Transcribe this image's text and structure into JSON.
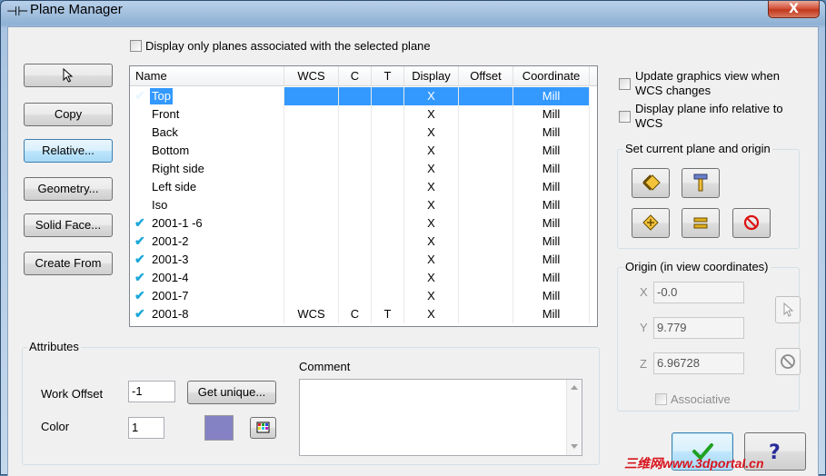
{
  "window": {
    "title": "Plane Manager",
    "close_glyph": "X"
  },
  "top_checkbox": {
    "label": "Display only planes associated with the selected plane"
  },
  "left_buttons": [
    "Copy",
    "Relative...",
    "Geometry...",
    "Solid Face...",
    "Create From"
  ],
  "table": {
    "columns": [
      "Name",
      "WCS",
      "C",
      "T",
      "Display",
      "Offset",
      "Coordinate"
    ],
    "rows": [
      {
        "check": "✔",
        "name": "Top",
        "wcs": "",
        "c": "",
        "t": "",
        "display": "X",
        "offset": "",
        "coord": "Mill",
        "selected": true
      },
      {
        "check": "",
        "name": "Front",
        "wcs": "",
        "c": "",
        "t": "",
        "display": "X",
        "offset": "",
        "coord": "Mill"
      },
      {
        "check": "",
        "name": "Back",
        "wcs": "",
        "c": "",
        "t": "",
        "display": "X",
        "offset": "",
        "coord": "Mill"
      },
      {
        "check": "",
        "name": "Bottom",
        "wcs": "",
        "c": "",
        "t": "",
        "display": "X",
        "offset": "",
        "coord": "Mill"
      },
      {
        "check": "",
        "name": "Right side",
        "wcs": "",
        "c": "",
        "t": "",
        "display": "X",
        "offset": "",
        "coord": "Mill"
      },
      {
        "check": "",
        "name": "Left side",
        "wcs": "",
        "c": "",
        "t": "",
        "display": "X",
        "offset": "",
        "coord": "Mill"
      },
      {
        "check": "",
        "name": "Iso",
        "wcs": "",
        "c": "",
        "t": "",
        "display": "X",
        "offset": "",
        "coord": "Mill"
      },
      {
        "check": "✔",
        "name": "2001-1 -6",
        "wcs": "",
        "c": "",
        "t": "",
        "display": "X",
        "offset": "",
        "coord": "Mill"
      },
      {
        "check": "✔",
        "name": "2001-2",
        "wcs": "",
        "c": "",
        "t": "",
        "display": "X",
        "offset": "",
        "coord": "Mill"
      },
      {
        "check": "✔",
        "name": "2001-3",
        "wcs": "",
        "c": "",
        "t": "",
        "display": "X",
        "offset": "",
        "coord": "Mill"
      },
      {
        "check": "✔",
        "name": "2001-4",
        "wcs": "",
        "c": "",
        "t": "",
        "display": "X",
        "offset": "",
        "coord": "Mill"
      },
      {
        "check": "✔",
        "name": "2001-7",
        "wcs": "",
        "c": "",
        "t": "",
        "display": "X",
        "offset": "",
        "coord": "Mill"
      },
      {
        "check": "✔",
        "name": "2001-8",
        "wcs": "WCS",
        "c": "C",
        "t": "T",
        "display": "X",
        "offset": "",
        "coord": "Mill"
      }
    ]
  },
  "right_options": {
    "update_graphics": "Update graphics view when WCS changes",
    "display_relative": "Display plane info relative to WCS"
  },
  "set_plane_group": {
    "title": "Set current plane and origin"
  },
  "origin_group": {
    "title": "Origin (in view coordinates)",
    "x_label": "X",
    "x_value": "-0.0",
    "y_label": "Y",
    "y_value": "9.779",
    "z_label": "Z",
    "z_value": "6.96728",
    "associative": "Associative"
  },
  "attributes": {
    "title": "Attributes",
    "work_offset_label": "Work Offset",
    "work_offset_value": "-1",
    "get_unique": "Get unique...",
    "color_label": "Color",
    "color_value": "1",
    "swatch_color": "#8481c4",
    "comment_label": "Comment"
  },
  "watermark": "三维网www.3dportal.cn",
  "colors": {
    "selection": "#3399ff",
    "check": "#1aa7d8"
  }
}
